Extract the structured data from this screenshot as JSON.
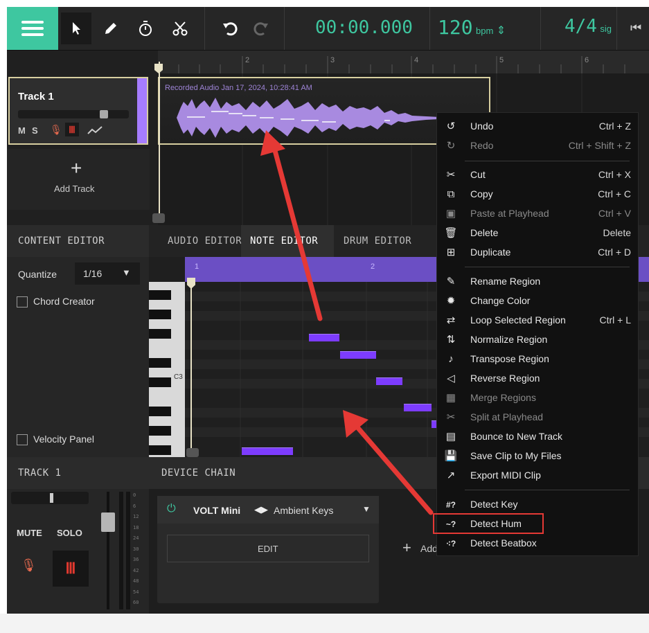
{
  "toolbar": {
    "time": "00:00.000",
    "bpm_value": "120",
    "bpm_unit": "bpm",
    "sig_value": "4/4",
    "sig_unit": "sig",
    "icons": [
      "menu-icon",
      "pointer-icon",
      "pencil-icon",
      "timer-icon",
      "scissors-icon",
      "undo-icon",
      "redo-icon",
      "skip-to-start-icon"
    ]
  },
  "ruler": {
    "bars": [
      "2",
      "3",
      "4",
      "5",
      "6"
    ]
  },
  "track": {
    "name": "Track 1",
    "mute": "M",
    "solo": "S",
    "color": "#a67dff"
  },
  "add_track": "Add Track",
  "region": {
    "label": "Recorded Audio Jan 17, 2024, 10:28:41 AM"
  },
  "content_editor": {
    "title": "CONTENT EDITOR",
    "quantize_label": "Quantize",
    "quantize_value": "1/16",
    "chord_creator": "Chord Creator",
    "velocity_panel": "Velocity Panel"
  },
  "editor_tabs": [
    "AUDIO EDITOR",
    "NOTE EDITOR",
    "DRUM EDITOR"
  ],
  "note_editor": {
    "bars": [
      "1",
      "2"
    ],
    "c3_label": "C3"
  },
  "track_panel": {
    "title": "TRACK 1",
    "mute": "MUTE",
    "solo": "SOLO",
    "meter_ticks": [
      "0",
      "6",
      "12",
      "18",
      "24",
      "30",
      "36",
      "42",
      "48",
      "54",
      "60"
    ]
  },
  "device_chain": {
    "title": "DEVICE CHAIN",
    "instrument": "VOLT Mini",
    "preset": "Ambient Keys",
    "edit": "EDIT",
    "add": "Add"
  },
  "context_menu": {
    "items": [
      {
        "icon": "undo-icon",
        "glyph": "↺",
        "label": "Undo",
        "shortcut": "Ctrl + Z",
        "disabled": false
      },
      {
        "icon": "redo-icon",
        "glyph": "↻",
        "label": "Redo",
        "shortcut": "Ctrl + Shift + Z",
        "disabled": true
      },
      {
        "icon": "cut-icon",
        "glyph": "✂",
        "label": "Cut",
        "shortcut": "Ctrl + X",
        "disabled": false
      },
      {
        "icon": "copy-icon",
        "glyph": "⧉",
        "label": "Copy",
        "shortcut": "Ctrl + C",
        "disabled": false
      },
      {
        "icon": "paste-icon",
        "glyph": "▣",
        "label": "Paste at Playhead",
        "shortcut": "Ctrl + V",
        "disabled": true
      },
      {
        "icon": "delete-icon",
        "glyph": "🗑",
        "label": "Delete",
        "shortcut": "Delete",
        "disabled": false
      },
      {
        "icon": "duplicate-icon",
        "glyph": "⊞",
        "label": "Duplicate",
        "shortcut": "Ctrl + D",
        "disabled": false
      },
      {
        "icon": "rename-icon",
        "glyph": "✎",
        "label": "Rename Region",
        "shortcut": "",
        "disabled": false
      },
      {
        "icon": "color-icon",
        "glyph": "✹",
        "label": "Change Color",
        "shortcut": "",
        "disabled": false
      },
      {
        "icon": "loop-icon",
        "glyph": "⇄",
        "label": "Loop Selected Region",
        "shortcut": "Ctrl + L",
        "disabled": false
      },
      {
        "icon": "normalize-icon",
        "glyph": "⇅",
        "label": "Normalize Region",
        "shortcut": "",
        "disabled": false
      },
      {
        "icon": "transpose-icon",
        "glyph": "♪",
        "label": "Transpose Region",
        "shortcut": "",
        "disabled": false
      },
      {
        "icon": "reverse-icon",
        "glyph": "◁",
        "label": "Reverse Region",
        "shortcut": "",
        "disabled": false
      },
      {
        "icon": "merge-icon",
        "glyph": "▦",
        "label": "Merge Regions",
        "shortcut": "",
        "disabled": true
      },
      {
        "icon": "split-icon",
        "glyph": "✂",
        "label": "Split at Playhead",
        "shortcut": "",
        "disabled": true
      },
      {
        "icon": "bounce-icon",
        "glyph": "▤",
        "label": "Bounce to New Track",
        "shortcut": "",
        "disabled": false
      },
      {
        "icon": "save-icon",
        "glyph": "💾",
        "label": "Save Clip to My Files",
        "shortcut": "",
        "disabled": false
      },
      {
        "icon": "export-icon",
        "glyph": "↗",
        "label": "Export MIDI Clip",
        "shortcut": "",
        "disabled": false
      },
      {
        "icon": "detect-key-icon",
        "glyph": "#?",
        "label": "Detect Key",
        "shortcut": "",
        "disabled": false
      },
      {
        "icon": "detect-hum-icon",
        "glyph": "~?",
        "label": "Detect Hum",
        "shortcut": "",
        "disabled": false,
        "highlighted": true
      },
      {
        "icon": "detect-beatbox-icon",
        "glyph": "⁖?",
        "label": "Detect Beatbox",
        "shortcut": "",
        "disabled": false
      }
    ]
  },
  "colors": {
    "accent": "#3ec7a0",
    "note": "#7d3cff",
    "highlight_box": "#e53935",
    "arrow": "#e53935",
    "track_color": "#a67dff"
  }
}
